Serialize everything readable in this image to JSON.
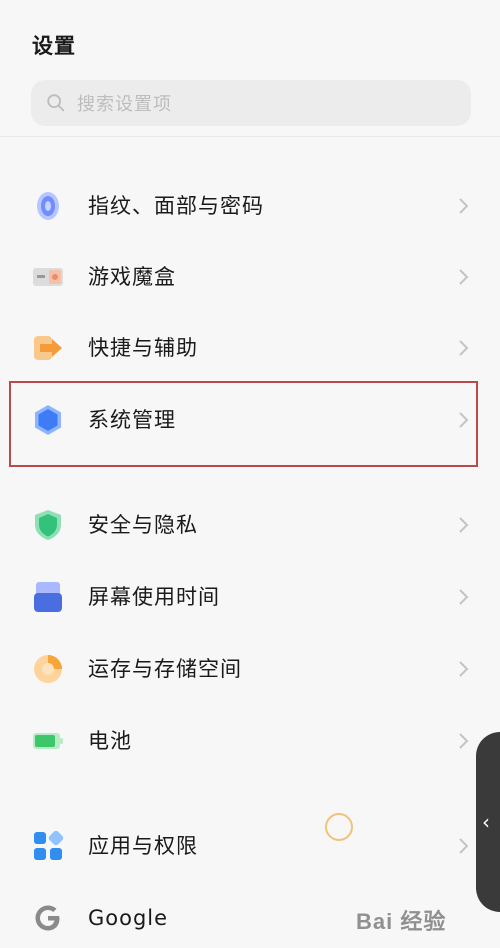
{
  "header": {
    "title": "设置"
  },
  "search": {
    "placeholder": "搜索设置项"
  },
  "items": [
    {
      "label": "指纹、面部与密码",
      "icon": "fingerprint-icon",
      "color": "#6f8dff"
    },
    {
      "label": "游戏魔盒",
      "icon": "game-box-icon",
      "color": "#f08a6a"
    },
    {
      "label": "快捷与辅助",
      "icon": "shortcut-icon",
      "color": "#f59b3a"
    },
    {
      "label": "系统管理",
      "icon": "system-hexagon-icon",
      "color": "#3d7cf5"
    },
    {
      "label": "安全与隐私",
      "icon": "shield-icon",
      "color": "#34c27a"
    },
    {
      "label": "屏幕使用时间",
      "icon": "screen-time-icon",
      "color": "#4a6ee0"
    },
    {
      "label": "运存与存储空间",
      "icon": "storage-pie-icon",
      "color": "#f5a53a"
    },
    {
      "label": "电池",
      "icon": "battery-icon",
      "color": "#3ec76a"
    },
    {
      "label": "应用与权限",
      "icon": "apps-grid-icon",
      "color": "#2f8ef0"
    },
    {
      "label": "Google",
      "icon": "google-icon",
      "color": "#8a8a8a"
    }
  ],
  "watermark": {
    "text": "Bai 经验"
  }
}
